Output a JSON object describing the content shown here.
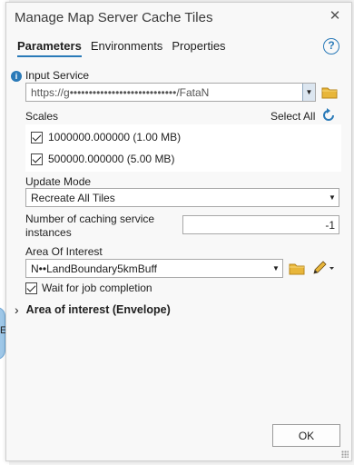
{
  "dialog": {
    "title": "Manage Map Server Cache Tiles",
    "close_glyph": "✕"
  },
  "tabs": [
    {
      "label": "Parameters",
      "active": true
    },
    {
      "label": "Environments",
      "active": false
    },
    {
      "label": "Properties",
      "active": false
    }
  ],
  "help_glyph": "?",
  "input_service": {
    "label": "Input Service",
    "value": "https://g••••••••••••••••••••••••••••/FataN",
    "info_glyph": "i"
  },
  "scales": {
    "label": "Scales",
    "select_all_label": "Select All",
    "items": [
      {
        "label": "1000000.000000 (1.00 MB)",
        "checked": true
      },
      {
        "label": "500000.000000 (5.00 MB)",
        "checked": true
      }
    ]
  },
  "update_mode": {
    "label": "Update Mode",
    "value": "Recreate All Tiles"
  },
  "caching_instances": {
    "label_line1": "Number of caching service",
    "label_line2": "instances",
    "value": "-1"
  },
  "area_of_interest": {
    "label": "Area Of Interest",
    "value": "N••LandBoundary5kmBuff"
  },
  "wait_for_job": {
    "label": "Wait for job completion",
    "checked": true
  },
  "envelope_section": {
    "label": "Area of interest (Envelope)",
    "expand_glyph": "›"
  },
  "ok_label": "OK",
  "background": {
    "node_letter": "E"
  },
  "colors": {
    "accent": "#2a7ab8",
    "folder": "#e8b63a"
  },
  "icons": [
    "info-icon",
    "help-icon",
    "close-icon",
    "folder-icon",
    "refresh-icon",
    "pencil-icon",
    "chevron-down-icon",
    "expand-icon"
  ]
}
